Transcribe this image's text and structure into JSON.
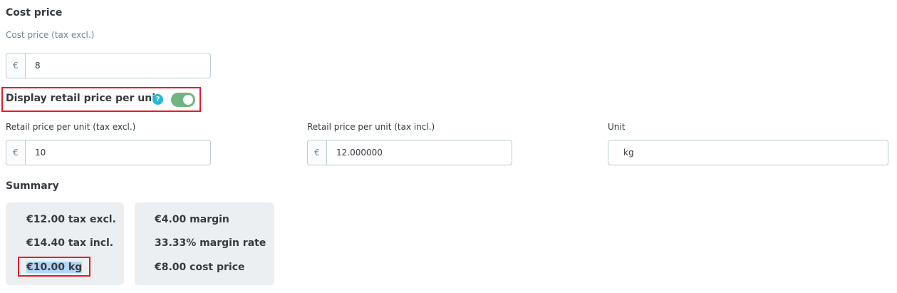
{
  "cost_price": {
    "heading": "Cost price",
    "field_label": "Cost price (tax excl.)",
    "currency_symbol": "€",
    "value": "8"
  },
  "retail_unit": {
    "toggle_label": "Display retail price per unit",
    "help_icon": "?",
    "toggle_on": true,
    "tax_excl": {
      "label": "Retail price per unit (tax excl.)",
      "currency_symbol": "€",
      "value": "10"
    },
    "tax_incl": {
      "label": "Retail price per unit (tax incl.)",
      "currency_symbol": "€",
      "value": "12.000000"
    },
    "unit": {
      "label": "Unit",
      "value": "kg"
    }
  },
  "summary": {
    "heading": "Summary",
    "card1": [
      "€12.00 tax excl.",
      "€14.40 tax incl.",
      "€10.00 kg"
    ],
    "card2": [
      "€4.00 margin",
      "33.33% margin rate",
      "€8.00 cost price"
    ]
  },
  "colors": {
    "highlight": "#e01f26",
    "toggle_on": "#70b580",
    "help_icon": "#25b9d7",
    "card_bg": "#eceff1",
    "selection": "#b5d5f5"
  }
}
